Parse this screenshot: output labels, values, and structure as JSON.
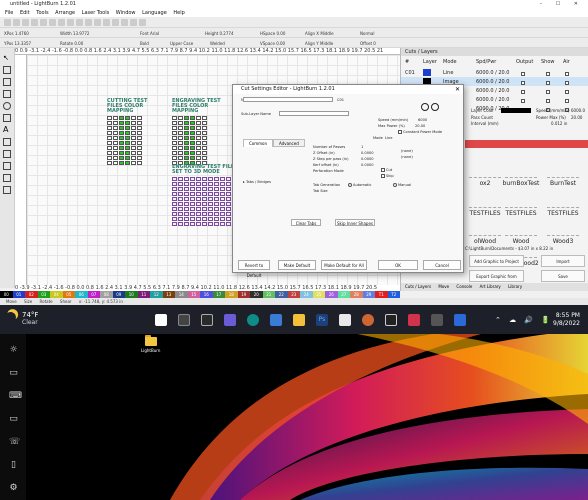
{
  "app": {
    "title": "untitled - LightBurn 1.2.01",
    "window_controls": "– ☐ ✕",
    "menu": [
      "File",
      "Edit",
      "Tools",
      "Arrange",
      "Laser Tools",
      "Window",
      "Language",
      "Help"
    ],
    "toolbar_texts": [
      "Font Arial",
      "Height 0.2774",
      "HSpace 0.00",
      "Align X Middle",
      "Normal",
      "Bold",
      "Upper Case",
      "Welded",
      "VSpace 0.00",
      "Align Y Middle",
      "Offset 0",
      "XPos 1.4760",
      "YPos 13.3357",
      "Width 13.9772",
      "Height 0.4",
      "Rotate 0.00"
    ],
    "ruler_top": "0  0.9  -3.1  -2.4  -1.6  -0.8  0.0  0.8  1.6  2.4  3.1  3.9  4.7  5.5  6.3  7.1  7.9  8.7  9.4  10.2  11.0  11.8  12.6  13.4  14.2  15.0  15.7  16.5  17.3  18.1  18.9  19.7  20.5  21",
    "ruler_bottom": "0  -3.9  -3.1  -2.4  -1.6  -0.8  0.0  0.8  1.6  2.4  3.1  3.9  4.7  5.5  6.3  7.1  7.9  8.7  9.4  10.2  11.0  11.8  12.6  13.4  14.2  15.0  15.7  16.5  17.3  18.1  18.9  19.7  20.5",
    "palette": [
      {
        "label": "00",
        "color": "#000000"
      },
      {
        "label": "01",
        "color": "#1e3ecc"
      },
      {
        "label": "02",
        "color": "#d42020"
      },
      {
        "label": "03",
        "color": "#1ea01e"
      },
      {
        "label": "04",
        "color": "#c8c81e"
      },
      {
        "label": "05",
        "color": "#e07a10"
      },
      {
        "label": "06",
        "color": "#20b8c8"
      },
      {
        "label": "07",
        "color": "#c020c8"
      },
      {
        "label": "08",
        "color": "#a0a0a0"
      },
      {
        "label": "09",
        "color": "#1a3a8a"
      },
      {
        "label": "10",
        "color": "#1e7a1e"
      },
      {
        "label": "11",
        "color": "#7a1e7a"
      },
      {
        "label": "12",
        "color": "#20a0a0"
      },
      {
        "label": "13",
        "color": "#7a4010"
      },
      {
        "label": "14",
        "color": "#8a8a8a"
      },
      {
        "label": "15",
        "color": "#d060a0"
      },
      {
        "label": "16",
        "color": "#5050e0"
      },
      {
        "label": "17",
        "color": "#3a8a3a"
      },
      {
        "label": "18",
        "color": "#d0a020"
      },
      {
        "label": "19",
        "color": "#a03030"
      },
      {
        "label": "20",
        "color": "#303030"
      },
      {
        "label": "21",
        "color": "#60c060"
      },
      {
        "label": "22",
        "color": "#4060a0"
      },
      {
        "label": "23",
        "color": "#c04040"
      },
      {
        "label": "24",
        "color": "#80c0e0"
      },
      {
        "label": "25",
        "color": "#e0e060"
      },
      {
        "label": "26",
        "color": "#a060e0"
      },
      {
        "label": "27",
        "color": "#60e0a0"
      },
      {
        "label": "28",
        "color": "#e08060"
      },
      {
        "label": "29",
        "color": "#6080e0"
      },
      {
        "label": "T1",
        "color": "#e02020"
      },
      {
        "label": "T2",
        "color": "#2060e0"
      }
    ],
    "status": [
      "Move",
      "Size",
      "Rotate",
      "Shear",
      "x: -11.748, y: 4.573 in"
    ]
  },
  "canvas": {
    "design1_title": "CUTTING TEST FILES COLOR MAPPING",
    "design2_title": "ENGRAVING TEST FILES COLOR MAPPING",
    "design3_title": "ENGRAVING TEST FILES SET TO 3D MODE"
  },
  "cuts_panel": {
    "header": "Cuts / Layers",
    "columns": [
      "#",
      "Layer",
      "Mode",
      "Spd/Pwr",
      "Output",
      "Show",
      "Air"
    ],
    "rows": [
      {
        "num": "C01",
        "mode": "Line",
        "spdpwr": "6000.0 / 20.0",
        "color": "#1e3ecc"
      },
      {
        "num": "",
        "mode": "Image",
        "spdpwr": "6000.0 / 20.0",
        "color": "#000000"
      },
      {
        "num": "",
        "mode": "Image",
        "spdpwr": "6000.0 / 20.0",
        "color": "#000000"
      },
      {
        "num": "",
        "mode": "Image",
        "spdpwr": "6000.0 / 20.0",
        "color": "#000000"
      },
      {
        "num": "",
        "mode": "Image",
        "spdpwr": "6000.0 / 20.0",
        "color": "#000000"
      }
    ],
    "layer_color_label": "Layer Color",
    "speed_label": "Speed (mm/min)",
    "speed_value": "6000.0",
    "power_label": "Power Max (%)",
    "power_value": "20.00",
    "passcount_label": "Pass Count",
    "interval_label": "Interval (mm)",
    "interval_value": "0.012 in"
  },
  "library": {
    "tiles": [
      "ox2",
      "burnBoxTest",
      "BurnTest",
      "TESTFILES",
      "TESTFILES",
      "TESTFILES",
      "olWood",
      "Wood",
      "Wood3",
      "xtoolWood",
      "xtoolWood2"
    ],
    "footer_path": "C:\\LightBurn\\Documents - $3.07 in x 8.22 in",
    "buttons": [
      "Add Graphic to Project",
      "Export Graphic from Project",
      "Import",
      "Save"
    ],
    "tabs": [
      "Cuts / Layers",
      "Move",
      "Console",
      "Art Library",
      "Library"
    ]
  },
  "dialog": {
    "title": "Cut Settings Editor - LightBurn 1.2.01",
    "close": "✕",
    "name_label": "Name",
    "name_value": "C01",
    "sublayer_label": "Sub-Layer Name",
    "speed_label": "Speed (mm/min)",
    "speed_value": "6000",
    "maxpower_label": "Max Power (%)",
    "maxpower_value": "20.00",
    "constant_power": "Constant Power Mode",
    "mode_label": "Mode",
    "mode_value": "Line",
    "tabs": [
      "Common",
      "Advanced"
    ],
    "fields": [
      {
        "label": "Number of Passes",
        "value": "1"
      },
      {
        "label": "Z Offset (in)",
        "value": "0.0000"
      },
      {
        "label": "Z Step per pass (in)",
        "value": "0.0000"
      },
      {
        "label": "Kerf offset (in)",
        "value": "0.0000"
      },
      {
        "label": "Perforation Mode",
        "value": ""
      }
    ],
    "none_label": "(none)",
    "cut_label": "Cut",
    "skip_label": "Skip",
    "tabs_bridges": "Tabs / Bridges",
    "tab_gen": "Tab Generation",
    "automatic": "Automatic",
    "manual": "Manual",
    "tab_size": "Tab Size",
    "skip_inner": "Skip Inner Shapes",
    "clear_tabs": "Clear Tabs",
    "buttons": [
      "Revert to Default",
      "Make Default",
      "Make Default for All",
      "OK",
      "Cancel"
    ]
  },
  "taskbar": {
    "temp": "74°F",
    "weather": "Clear",
    "time": "8:55 PM",
    "date": "9/8/2022",
    "tray_icons": "⌃ ☁ 🔊 🔋"
  },
  "desktop": {
    "folder_label": "LightBurn"
  }
}
